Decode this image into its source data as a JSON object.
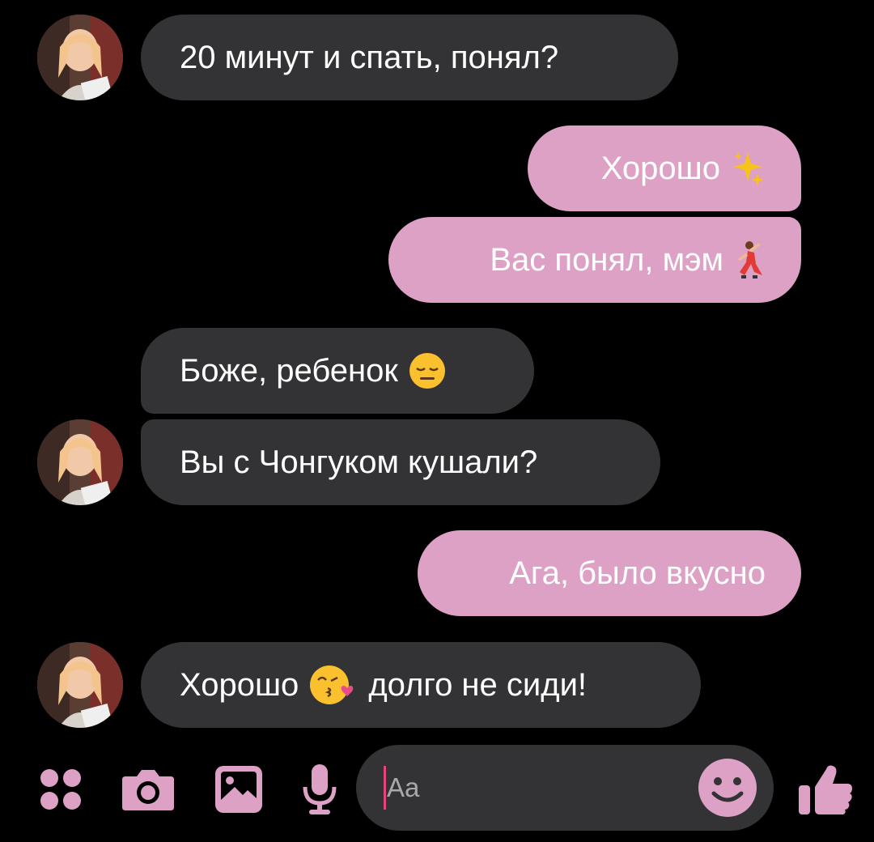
{
  "messages": [
    {
      "side": "in",
      "text": "20 минут и спать, понял?",
      "emoji": ""
    },
    {
      "side": "out",
      "text": "Хорошо",
      "emoji": "sparkles-emoji"
    },
    {
      "side": "out",
      "text": "Вас понял, мэм",
      "emoji": "dancer-emoji"
    },
    {
      "side": "in",
      "text": "Боже, ребенок",
      "emoji": "expressionless-face-emoji"
    },
    {
      "side": "in",
      "text": "Вы с Чонгуком кушали?",
      "emoji": ""
    },
    {
      "side": "out",
      "text": "Ага, было вкусно",
      "emoji": ""
    },
    {
      "side": "in",
      "text": "Хорошо",
      "emoji": "kissing-heart-face-emoji",
      "text_after": "долго не сиди!"
    }
  ],
  "composer": {
    "placeholder": "Aa"
  },
  "toolbar": {
    "icons": [
      "apps-icon",
      "camera-icon",
      "gallery-icon",
      "microphone-icon",
      "emoji-icon",
      "like-icon"
    ]
  },
  "colors": {
    "background": "#000000",
    "incoming_bubble": "#333335",
    "outgoing_bubble": "#dca1c5",
    "accent": "#dca1c5",
    "caret": "#e6457b"
  }
}
